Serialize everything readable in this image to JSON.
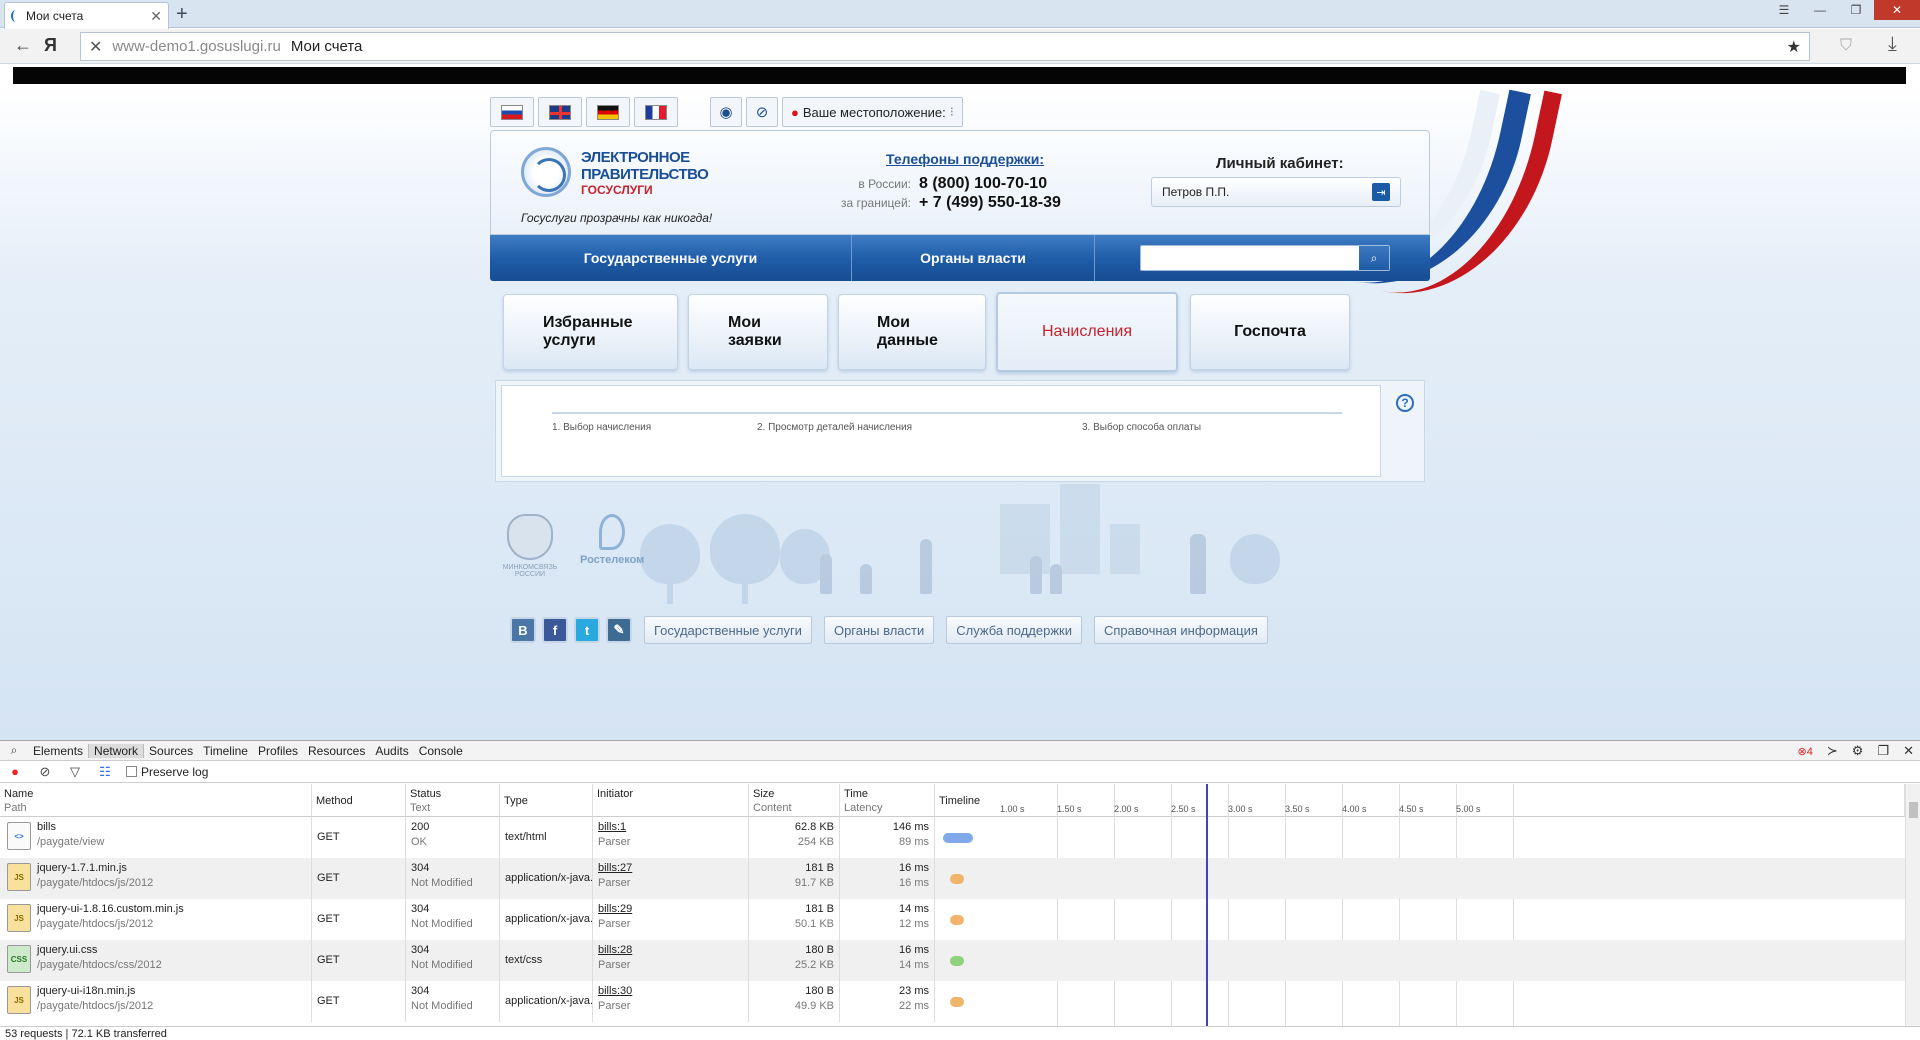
{
  "browser": {
    "tab_title": "Мои счета",
    "url_host": "www-demo1.gosuslugi.ru",
    "url_title": "Мои счета"
  },
  "site": {
    "location_label": "Ваше местоположение:",
    "logo_title": "ЭЛЕКТРОННОЕ ПРАВИТЕЛЬСТВО",
    "logo_subtitle": "ГОСУСЛУГИ",
    "tagline": "Госуслуги прозрачны как никогда!",
    "phones_title": "Телефоны поддержки",
    "phones": [
      {
        "label": "в России:",
        "number": "8 (800) 100-70-10"
      },
      {
        "label": "за границей:",
        "number": "+ 7 (499) 550-18-39"
      }
    ],
    "cabinet_title": "Личный кабинет:",
    "cabinet_user": "Петров П.П.",
    "nav": [
      "Государственные услуги",
      "Органы власти"
    ],
    "big_tabs": [
      {
        "label": "Избранные услуги",
        "active": false
      },
      {
        "label": "Мои заявки",
        "active": false
      },
      {
        "label": "Мои данные",
        "active": false
      },
      {
        "label": "Начисления",
        "active": true
      },
      {
        "label": "Госпочта",
        "active": false
      }
    ],
    "steps": [
      "1. Выбор начисления",
      "2. Просмотр деталей начисления",
      "3. Выбор способа оплаты"
    ],
    "minsvyaz": "МИНКОМСВЯЗЬ РОССИИ",
    "rostelecom": "Ростелеком",
    "footer_links": [
      "Государственные услуги",
      "Органы власти",
      "Служба поддержки",
      "Справочная информация"
    ],
    "colors": {
      "brand_blue": "#1e5ba6",
      "brand_red": "#c5232d"
    }
  },
  "devtools": {
    "tabs": [
      "Elements",
      "Network",
      "Sources",
      "Timeline",
      "Profiles",
      "Resources",
      "Audits",
      "Console"
    ],
    "active_tab": "Network",
    "error_count": "4",
    "preserve_log": "Preserve log",
    "columns": [
      {
        "name": "Name",
        "sub": "Path"
      },
      {
        "name": "Method",
        "sub": ""
      },
      {
        "name": "Status",
        "sub": "Text"
      },
      {
        "name": "Type",
        "sub": ""
      },
      {
        "name": "Initiator",
        "sub": ""
      },
      {
        "name": "Size",
        "sub": "Content"
      },
      {
        "name": "Time",
        "sub": "Latency"
      },
      {
        "name": "Timeline",
        "sub": ""
      }
    ],
    "timeline_ticks": [
      "1.00 s",
      "1.50 s",
      "2.00 s",
      "2.50 s",
      "3.00 s",
      "3.50 s",
      "4.00 s",
      "4.50 s",
      "5.00 s"
    ],
    "requests": [
      {
        "name": "bills",
        "path": "/paygate/view",
        "method": "GET",
        "status": "200",
        "status_text": "OK",
        "type": "text/html",
        "initiator": "bills:1",
        "initiator_sub": "Parser",
        "size": "62.8 KB",
        "content": "254 KB",
        "time": "146 ms",
        "latency": "89 ms",
        "icon": "html",
        "dot_color": "#7fa9e8"
      },
      {
        "name": "jquery-1.7.1.min.js",
        "path": "/paygate/htdocs/js/2012",
        "method": "GET",
        "status": "304",
        "status_text": "Not Modified",
        "type": "application/x-java...",
        "initiator": "bills:27",
        "initiator_sub": "Parser",
        "size": "181 B",
        "content": "91.7 KB",
        "time": "16 ms",
        "latency": "16 ms",
        "icon": "js",
        "dot_color": "#f0b46a"
      },
      {
        "name": "jquery-ui-1.8.16.custom.min.js",
        "path": "/paygate/htdocs/js/2012",
        "method": "GET",
        "status": "304",
        "status_text": "Not Modified",
        "type": "application/x-java...",
        "initiator": "bills:29",
        "initiator_sub": "Parser",
        "size": "181 B",
        "content": "50.1 KB",
        "time": "14 ms",
        "latency": "12 ms",
        "icon": "js",
        "dot_color": "#f0b46a"
      },
      {
        "name": "jquery.ui.css",
        "path": "/paygate/htdocs/css/2012",
        "method": "GET",
        "status": "304",
        "status_text": "Not Modified",
        "type": "text/css",
        "initiator": "bills:28",
        "initiator_sub": "Parser",
        "size": "180 B",
        "content": "25.2 KB",
        "time": "16 ms",
        "latency": "14 ms",
        "icon": "css",
        "dot_color": "#8fd17c"
      },
      {
        "name": "jquery-ui-i18n.min.js",
        "path": "/paygate/htdocs/js/2012",
        "method": "GET",
        "status": "304",
        "status_text": "Not Modified",
        "type": "application/x-java...",
        "initiator": "bills:30",
        "initiator_sub": "Parser",
        "size": "180 B",
        "content": "49.9 KB",
        "time": "23 ms",
        "latency": "22 ms",
        "icon": "js",
        "dot_color": "#f0b46a"
      }
    ],
    "status_line": "53 requests | 72.1 KB transferred"
  }
}
